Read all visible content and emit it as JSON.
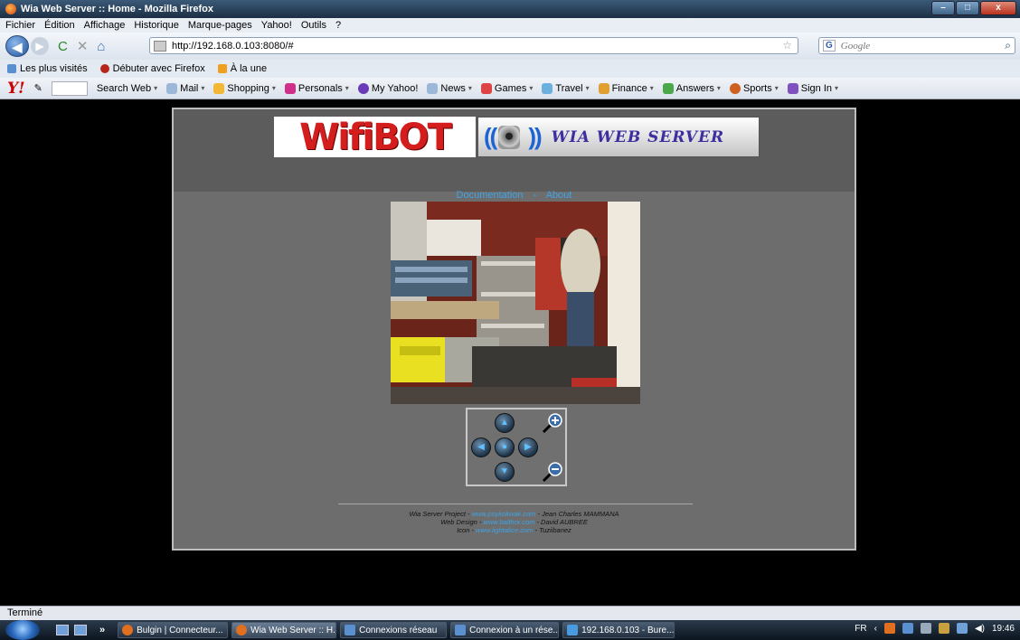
{
  "window": {
    "title": "Wia Web Server :: Home - Mozilla Firefox",
    "min": "–",
    "max": "□",
    "close": "x"
  },
  "menu": [
    "Fichier",
    "Édition",
    "Affichage",
    "Historique",
    "Marque-pages",
    "Yahoo!",
    "Outils",
    "?"
  ],
  "nav": {
    "back": "◀",
    "forward": "▶",
    "reload": "C",
    "stop": "✕",
    "home": "⌂",
    "url": "http://192.168.0.103:8080/#",
    "search_engine": "G",
    "search_placeholder": "Google"
  },
  "bookmarks": [
    "Les plus visités",
    "Débuter avec Firefox",
    "À la une"
  ],
  "yahoo_toolbar": {
    "logo": "Y!",
    "items": [
      "Search Web",
      "Mail",
      "Shopping",
      "Personals",
      "My Yahoo!",
      "News",
      "Games",
      "Travel",
      "Finance",
      "Answers",
      "Sports",
      "Sign In"
    ]
  },
  "site": {
    "logo_text": "WifiBOT",
    "logo2_text": "WIA WEB SERVER",
    "nav": {
      "documentation": "Documentation",
      "separator": "-",
      "about": "About"
    },
    "footer": {
      "line1_prefix": "Wia Server Project - ",
      "line1_link": "www.psykokwak.com",
      "line1_suffix": " - Jean Charles MAMMANA",
      "line2_prefix": "Web Design - ",
      "line2_link": "www.balthor.com",
      "line2_suffix": " - David AUBREE",
      "line3_prefix": "Icon - ",
      "line3_link": "www.lightalice.com",
      "line3_suffix": " - Tuziibanez"
    }
  },
  "status": "Terminé",
  "taskbar": {
    "tasks": [
      "Bulgin | Connecteur...",
      "Wia Web Server :: H...",
      "Connexions réseau",
      "Connexion à un rése...",
      "192.168.0.103 - Bure..."
    ],
    "lang": "FR",
    "time": "19:46"
  }
}
